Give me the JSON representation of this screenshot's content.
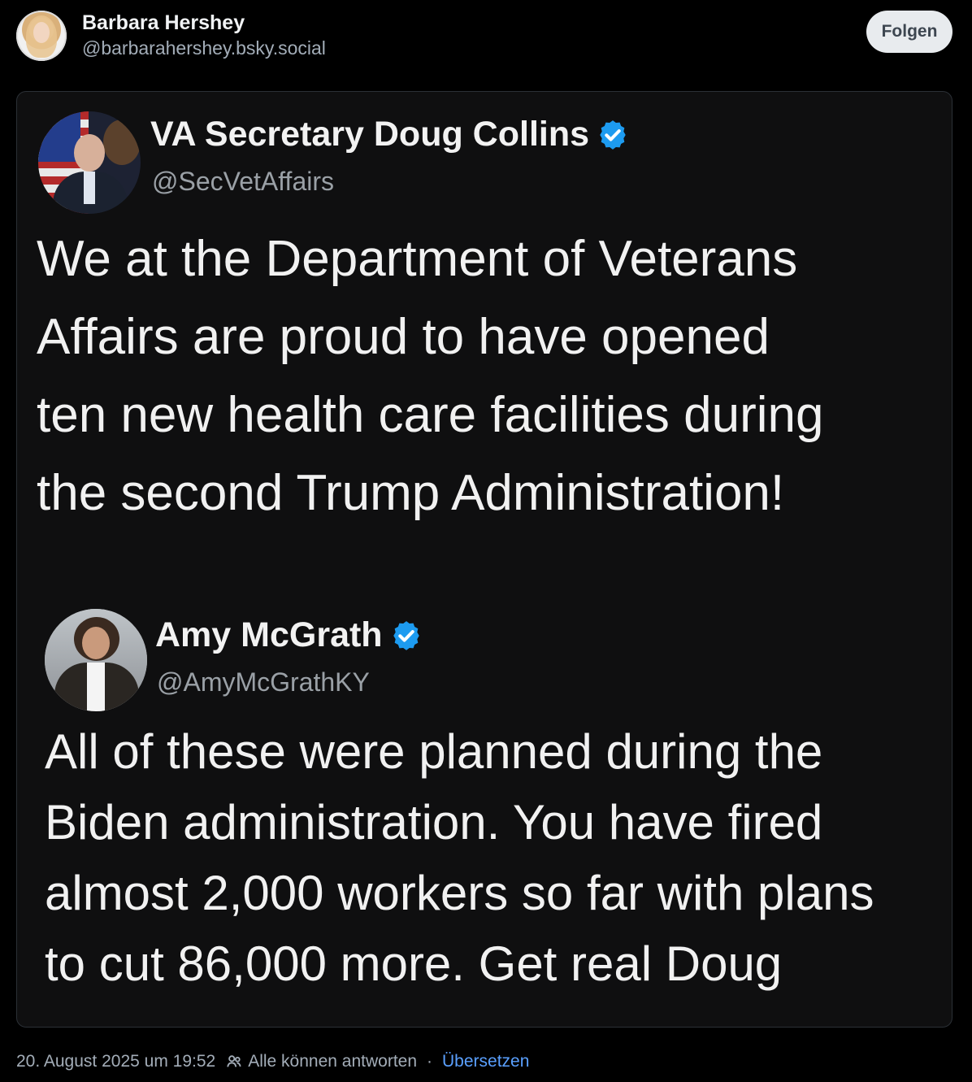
{
  "post": {
    "author_name": "Barbara Hershey",
    "author_handle": "@barbarahershey.bsky.social",
    "follow_label": "Folgen"
  },
  "embedded_image": {
    "tweet1": {
      "name": "VA Secretary Doug Collins",
      "handle": "@SecVetAffairs",
      "text": "We at the Department of Veterans\nAffairs are proud to have opened\nten new health care facilities during\nthe second Trump Administration!"
    },
    "tweet2": {
      "name": "Amy McGrath",
      "handle": "@AmyMcGrathKY",
      "text": "All of these were planned during the\nBiden administration. You have fired\nalmost 2,000 workers so far with plans\nto cut 86,000 more. Get real Doug"
    },
    "verified_badge_color": "#1d9bf0"
  },
  "meta": {
    "timestamp": "20. August 2025 um 19:52",
    "reply_setting": "Alle können antworten",
    "separator": "·",
    "translate_label": "Übersetzen",
    "translate_color": "#5aa0ff"
  },
  "icons": {
    "verified": "verified-check-icon",
    "reply_audience": "people-icon"
  }
}
